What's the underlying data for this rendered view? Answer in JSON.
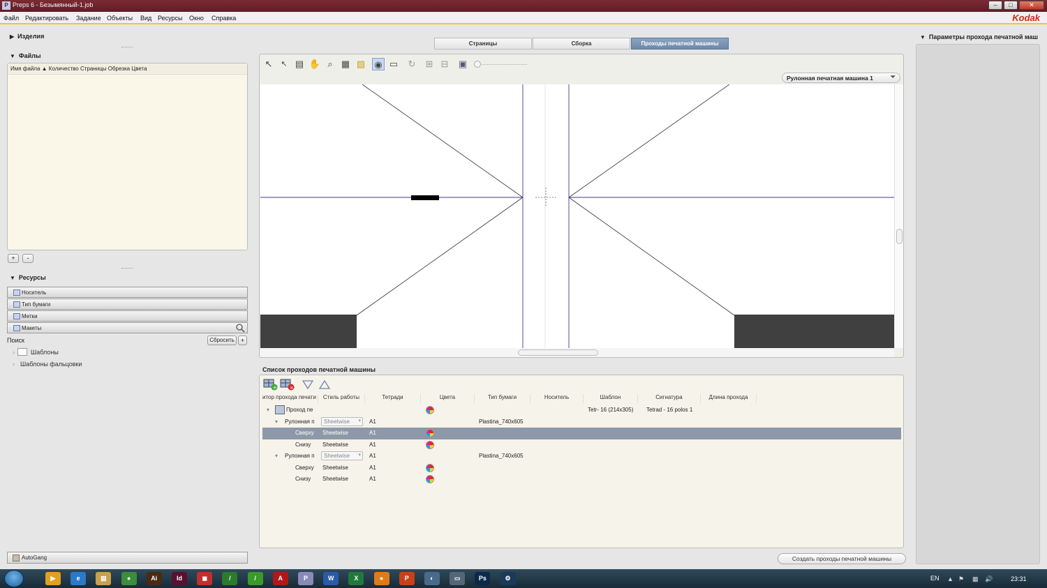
{
  "window": {
    "title": "Preps 6 - Безымянный-1.job",
    "app_icon_text": "P",
    "controls": {
      "minimize": "–",
      "maximize": "□",
      "close": "✕"
    }
  },
  "menubar": {
    "items": [
      "Файл",
      "Редактировать",
      "Задание",
      "Объекты",
      "Вид",
      "Ресурсы",
      "Окно",
      "Справка"
    ],
    "brand": "Kodak"
  },
  "left": {
    "products_title": "Изделия",
    "files_title": "Файлы",
    "files_header": "Имя файла ▲ Количество Страницы Обрезка Цвета",
    "add_btn": "+",
    "remove_btn": "-",
    "resources_title": "Ресурсы",
    "accordion": [
      "Носитель",
      "Тип бумаги",
      "Метки",
      "Макеты"
    ],
    "search_label": "Поиск",
    "reset_btn": "Сбросить",
    "plus_btn": "+",
    "tree": [
      "Шаблоны",
      "Шаблоны фальцовки"
    ],
    "autogang": "AutoGang"
  },
  "tabs": [
    {
      "label": "Страницы",
      "active": false
    },
    {
      "label": "Сборка",
      "active": false
    },
    {
      "label": "Проходы печатной машины",
      "active": true
    }
  ],
  "viewer": {
    "tools": [
      "arrow-select",
      "arrow-sub",
      "page-tool",
      "hand",
      "zoom",
      "grid",
      "layout-color",
      "eye",
      "ruler",
      "rotate",
      "tile-a",
      "tile-b",
      "monitor"
    ],
    "press_select": "Рулонная печатная машина 1"
  },
  "press_list": {
    "title": "Список проходов печатной машины",
    "columns": [
      "итор прохода печати",
      "Стиль работы",
      "Тетради",
      "Цвета",
      "Тип бумаги",
      "Носитель",
      "Шаблон",
      "Сигнатура",
      "Длина прохода"
    ],
    "rows": [
      {
        "level": 0,
        "toggle": "▾",
        "name": "Проход пе",
        "style": "",
        "style_combo": false,
        "sheet": "",
        "color": true,
        "paper": "",
        "template": "Tetr- 16 (214x305)",
        "signature": "Tetrad - 16 polos 1",
        "selected": false
      },
      {
        "level": 1,
        "toggle": "▾",
        "name": "Рулонная п",
        "style": "Sheetwise",
        "style_combo": true,
        "sheet": "A1",
        "color": false,
        "paper": "Plastina_740x605",
        "template": "",
        "signature": "",
        "selected": false
      },
      {
        "level": 2,
        "toggle": "",
        "name": "Сверху",
        "style": "Sheetwise",
        "style_combo": false,
        "sheet": "A1",
        "color": true,
        "paper": "",
        "template": "",
        "signature": "",
        "selected": true
      },
      {
        "level": 2,
        "toggle": "",
        "name": "Снизу",
        "style": "Sheetwise",
        "style_combo": false,
        "sheet": "A1",
        "color": true,
        "paper": "",
        "template": "",
        "signature": "",
        "selected": false
      },
      {
        "level": 1,
        "toggle": "▾",
        "name": "Рулонная п",
        "style": "Sheetwise",
        "style_combo": true,
        "sheet": "A1",
        "color": false,
        "paper": "Plastina_740x605",
        "template": "",
        "signature": "",
        "selected": false
      },
      {
        "level": 2,
        "toggle": "",
        "name": "Сверху",
        "style": "Sheetwise",
        "style_combo": false,
        "sheet": "A1",
        "color": true,
        "paper": "",
        "template": "",
        "signature": "",
        "selected": false
      },
      {
        "level": 2,
        "toggle": "",
        "name": "Снизу",
        "style": "Sheetwise",
        "style_combo": false,
        "sheet": "A1",
        "color": true,
        "paper": "",
        "template": "",
        "signature": "",
        "selected": false
      }
    ],
    "create_btn": "Создать проходы печатной машины"
  },
  "right": {
    "title": "Параметры прохода печатной маш"
  },
  "taskbar": {
    "apps": [
      {
        "icon": "media-player-icon",
        "label": "▶",
        "color": "#e0a020"
      },
      {
        "icon": "ie-icon",
        "label": "e",
        "color": "#2a7ac8"
      },
      {
        "icon": "explorer-icon",
        "label": "▤",
        "color": "#c8a050"
      },
      {
        "icon": "chrome-icon",
        "label": "●",
        "color": "#3b8e3b"
      },
      {
        "icon": "illustrator-icon",
        "label": "Ai",
        "color": "#4a2a10"
      },
      {
        "icon": "indesign-icon",
        "label": "Id",
        "color": "#5a1030"
      },
      {
        "icon": "security-icon",
        "label": "◼",
        "color": "#c0302a"
      },
      {
        "icon": "app-green-icon",
        "label": "/",
        "color": "#2c7a2c"
      },
      {
        "icon": "app-green2-icon",
        "label": "/",
        "color": "#3a9a2a"
      },
      {
        "icon": "acrobat-icon",
        "label": "A",
        "color": "#b01818"
      },
      {
        "icon": "preps-icon",
        "label": "P",
        "color": "#8a8ab8"
      },
      {
        "icon": "word-icon",
        "label": "W",
        "color": "#2a5aa8"
      },
      {
        "icon": "excel-icon",
        "label": "X",
        "color": "#1f7a3a"
      },
      {
        "icon": "firefox-icon",
        "label": "●",
        "color": "#e07a18"
      },
      {
        "icon": "powerpoint-icon",
        "label": "P",
        "color": "#c8401a"
      },
      {
        "icon": "network-icon",
        "label": "◐",
        "color": "#4a6a8a"
      },
      {
        "icon": "terminal-icon",
        "label": "▭",
        "color": "#556677"
      },
      {
        "icon": "photoshop-icon",
        "label": "Ps",
        "color": "#0a2a4a"
      },
      {
        "icon": "settings-icon",
        "label": "⚙",
        "color": "#1a3a5a"
      }
    ],
    "lang": "EN",
    "time": "23:31"
  },
  "colors": {
    "accent_tab": "#6d88aa",
    "selected_row": "#8d99a8",
    "menu_underline": "#f4c430",
    "brand": "#d0281c"
  }
}
